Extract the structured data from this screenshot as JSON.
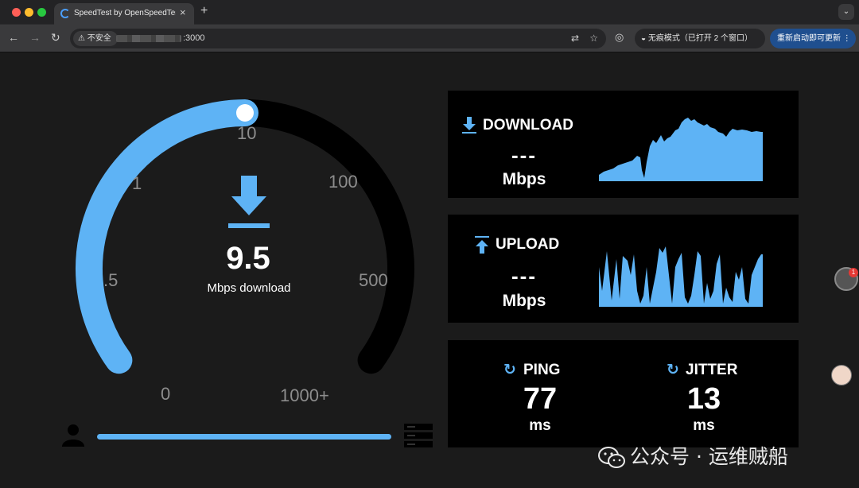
{
  "browser": {
    "tab_title": "SpeedTest by OpenSpeedTest",
    "tab_close": "×",
    "new_tab": "+",
    "tab_menu": "⌄",
    "insecure_label": "不安全",
    "url_port": ":3000",
    "incognito_label": "无痕模式（已打开 2 个窗口）",
    "relaunch_label": "重新启动即可更新"
  },
  "gauge": {
    "ticks": [
      "0",
      ".5",
      "1",
      "10",
      "100",
      "500",
      "1000+"
    ],
    "value": "9.5",
    "unit": "Mbps download",
    "level_fraction": 0.5,
    "accent_color": "#5eb3f5",
    "track_color": "#000000"
  },
  "download": {
    "title": "DOWNLOAD",
    "value": "---",
    "unit": "Mbps"
  },
  "upload": {
    "title": "UPLOAD",
    "value": "---",
    "unit": "Mbps"
  },
  "ping": {
    "title": "PING",
    "value": "77",
    "unit": "ms"
  },
  "jitter": {
    "title": "JITTER",
    "value": "13",
    "unit": "ms"
  },
  "extension_badge": "1",
  "watermark": "公众号 · 运维贼船"
}
